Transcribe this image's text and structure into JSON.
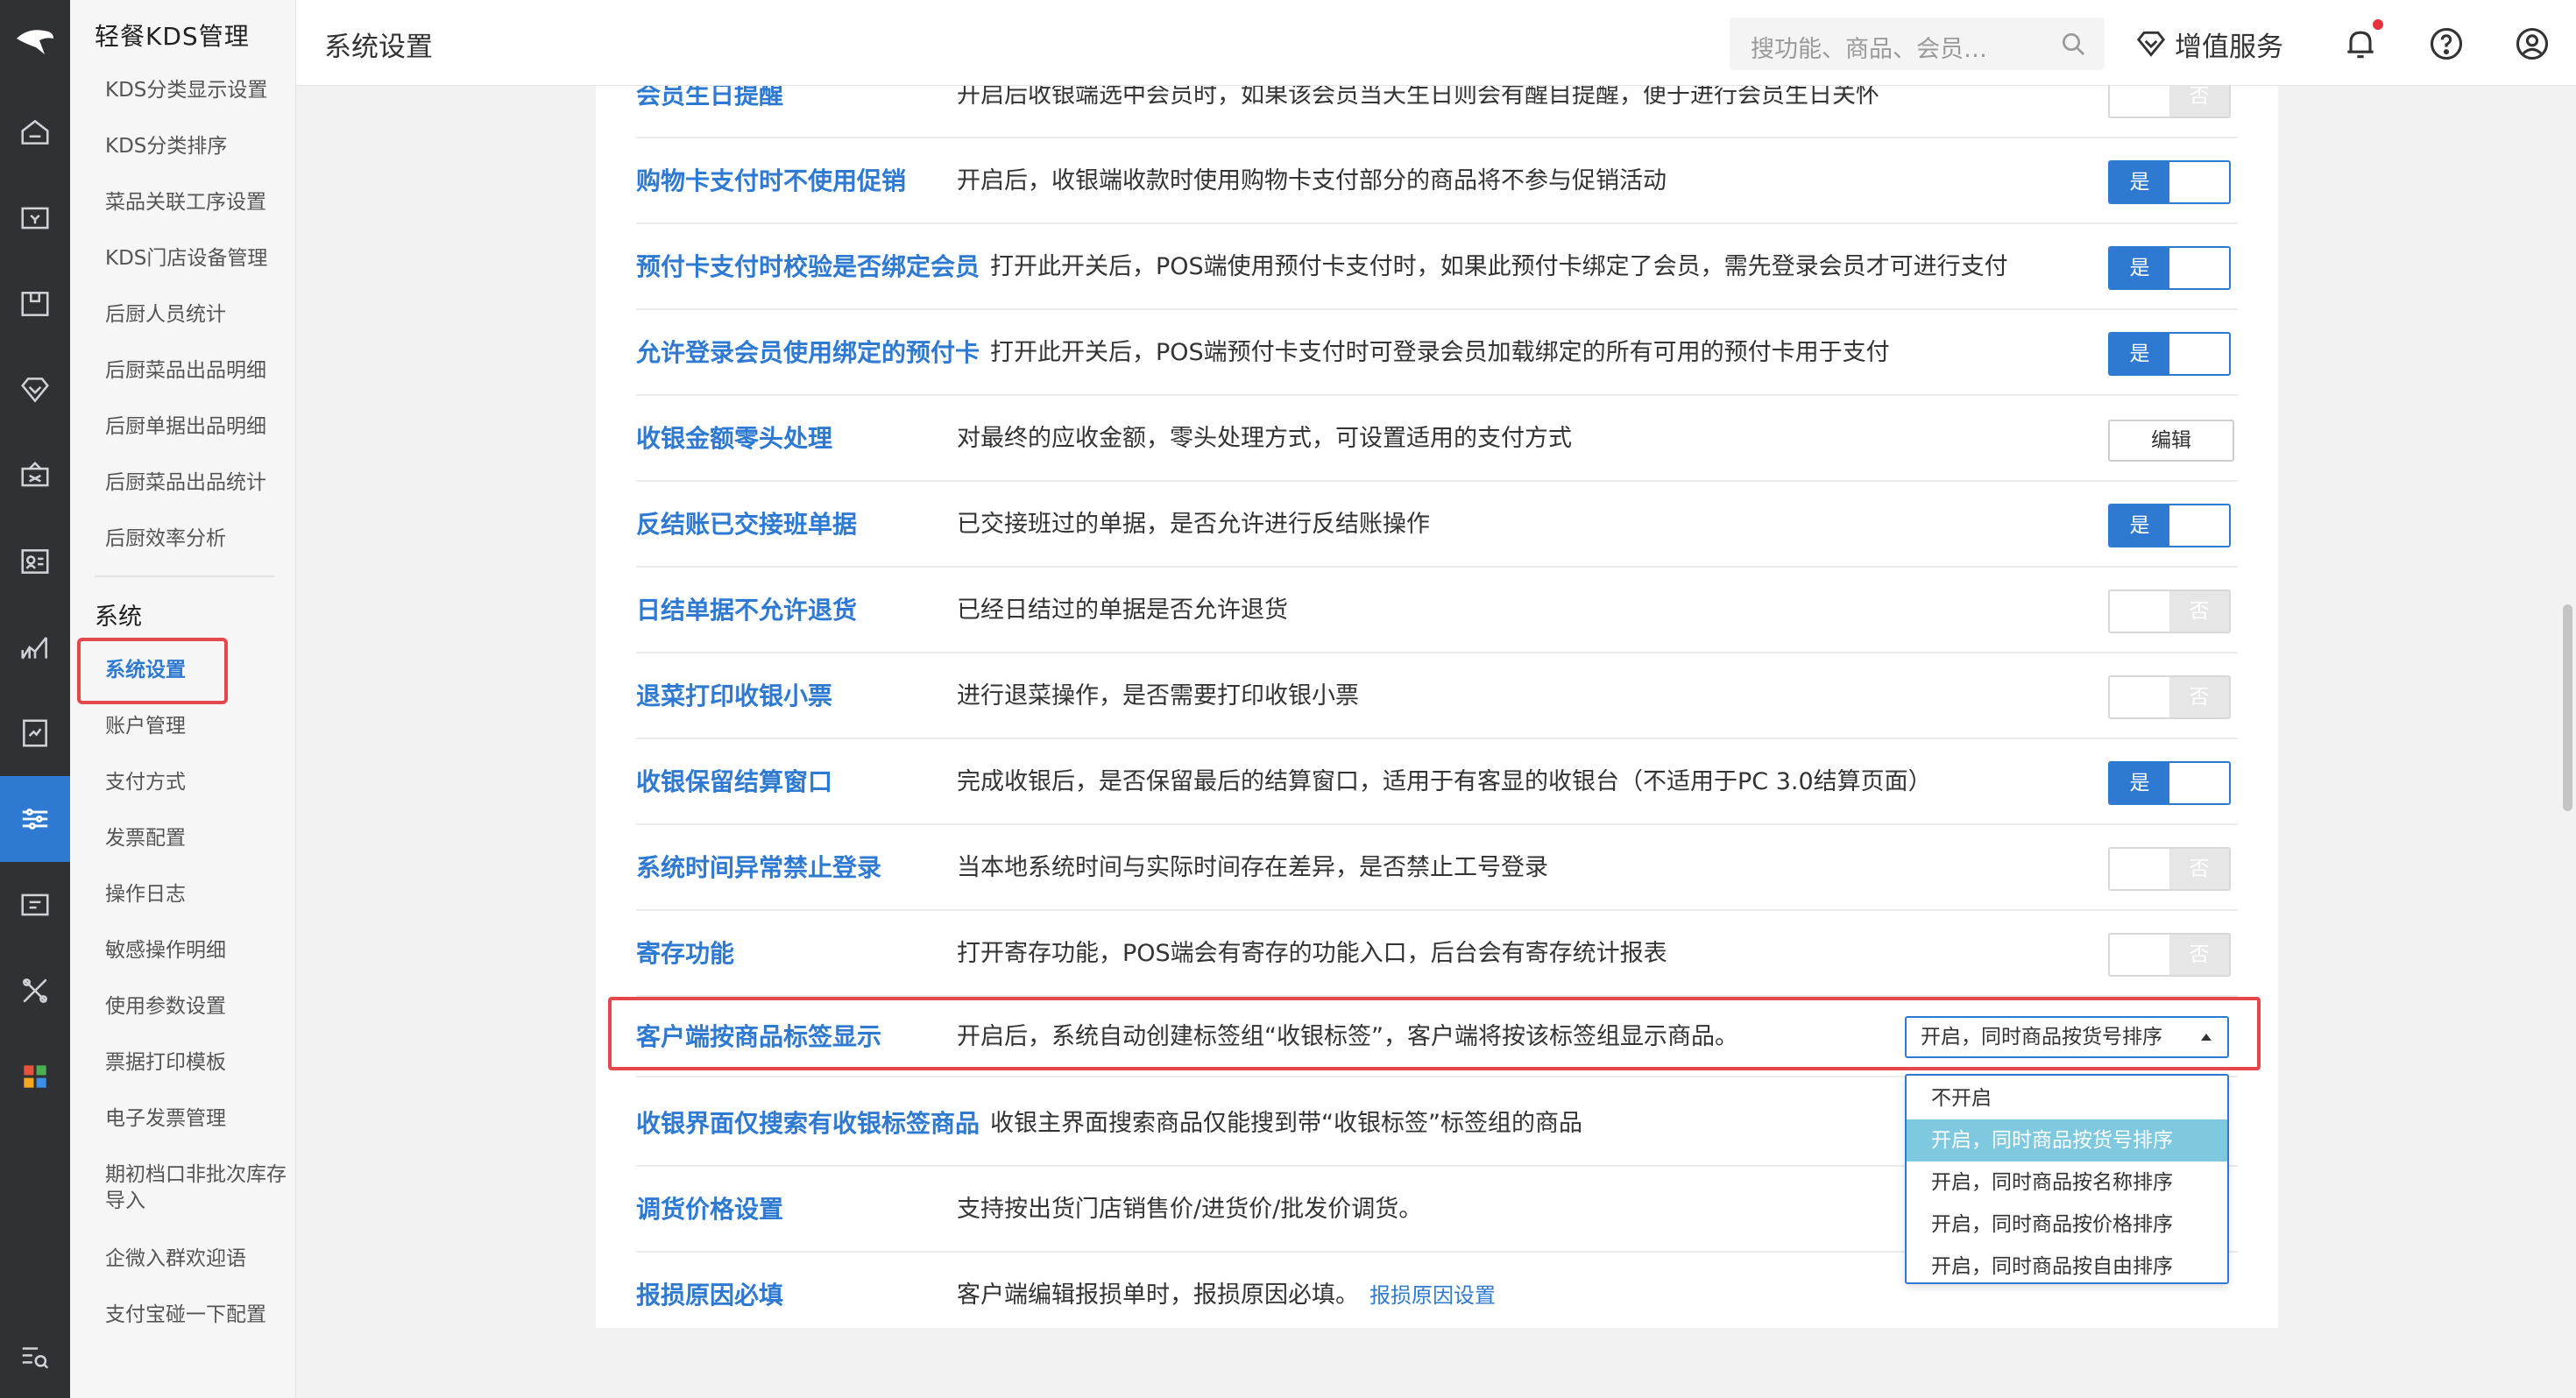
{
  "sidebar": {
    "title": "轻餐KDS管理",
    "items_top": [
      "KDS分类显示设置",
      "KDS分类排序",
      "菜品关联工序设置",
      "KDS门店设备管理",
      "后厨人员统计",
      "后厨菜品出品明细",
      "后厨单据出品明细",
      "后厨菜品出品统计",
      "后厨效率分析"
    ],
    "group": "系统",
    "items_system": [
      "系统设置",
      "账户管理",
      "支付方式",
      "发票配置",
      "操作日志",
      "敏感操作明细",
      "使用参数设置",
      "票据打印模板",
      "电子发票管理",
      "期初档口非批次库存导入",
      "企微入群欢迎语",
      "支付宝碰一下配置"
    ]
  },
  "header": {
    "title": "系统设置",
    "search_placeholder": "搜功能、商品、会员…",
    "value_added": "增值服务"
  },
  "settings": [
    {
      "name": "会员生日提醒",
      "desc": "开启后收银端选中会员时，如果该会员当天生日则会有醒目提醒，便于进行会员生日关怀",
      "control": "toggle",
      "state": "否"
    },
    {
      "name": "购物卡支付时不使用促销",
      "desc": "开启后，收银端收款时使用购物卡支付部分的商品将不参与促销活动",
      "control": "toggle",
      "state": "是"
    },
    {
      "name": "预付卡支付时校验是否绑定会员",
      "desc": "打开此开关后，POS端使用预付卡支付时，如果此预付卡绑定了会员，需先登录会员才可进行支付",
      "control": "toggle",
      "state": "是"
    },
    {
      "name": "允许登录会员使用绑定的预付卡",
      "desc": "打开此开关后，POS端预付卡支付时可登录会员加载绑定的所有可用的预付卡用于支付",
      "control": "toggle",
      "state": "是"
    },
    {
      "name": "收银金额零头处理",
      "desc": "对最终的应收金额，零头处理方式，可设置适用的支付方式",
      "control": "button",
      "button_label": "编辑"
    },
    {
      "name": "反结账已交接班单据",
      "desc": "已交接班过的单据，是否允许进行反结账操作",
      "control": "toggle",
      "state": "是"
    },
    {
      "name": "日结单据不允许退货",
      "desc": "已经日结过的单据是否允许退货",
      "control": "toggle",
      "state": "否"
    },
    {
      "name": "退菜打印收银小票",
      "desc": "进行退菜操作，是否需要打印收银小票",
      "control": "toggle",
      "state": "否"
    },
    {
      "name": "收银保留结算窗口",
      "desc": "完成收银后，是否保留最后的结算窗口，适用于有客显的收银台（不适用于PC 3.0结算页面）",
      "control": "toggle",
      "state": "是"
    },
    {
      "name": "系统时间异常禁止登录",
      "desc": "当本地系统时间与实际时间存在差异，是否禁止工号登录",
      "control": "toggle",
      "state": "否"
    },
    {
      "name": "寄存功能",
      "desc": "打开寄存功能，POS端会有寄存的功能入口，后台会有寄存统计报表",
      "control": "toggle",
      "state": "否"
    },
    {
      "name": "客户端按商品标签显示",
      "desc": "开启后，系统自动创建标签组“收银标签”，客户端将按该标签组显示商品。",
      "control": "select",
      "value": "开启，同时商品按货号排序"
    },
    {
      "name": "收银界面仅搜索有收银标签商品",
      "desc": "收银主界面搜索商品仅能搜到带“收银标签”标签组的商品",
      "control": "none"
    },
    {
      "name": "调货价格设置",
      "desc": "支持按出货门店销售价/进货价/批发价调货。",
      "control": "none"
    },
    {
      "name": "报损原因必填",
      "desc": "客户端编辑报损单时，报损原因必填。",
      "link": "报损原因设置",
      "control": "none"
    }
  ],
  "dropdown": {
    "options": [
      "不开启",
      "开启，同时商品按货号排序",
      "开启，同时商品按名称排序",
      "开启，同时商品按价格排序",
      "开启，同时商品按自由排序"
    ],
    "selected_index": 1
  },
  "colors": {
    "accent": "#2e7ad3",
    "rail_bg": "#2f3135",
    "highlight": "#e5474f",
    "dropdown_selected": "#7ec9df"
  }
}
